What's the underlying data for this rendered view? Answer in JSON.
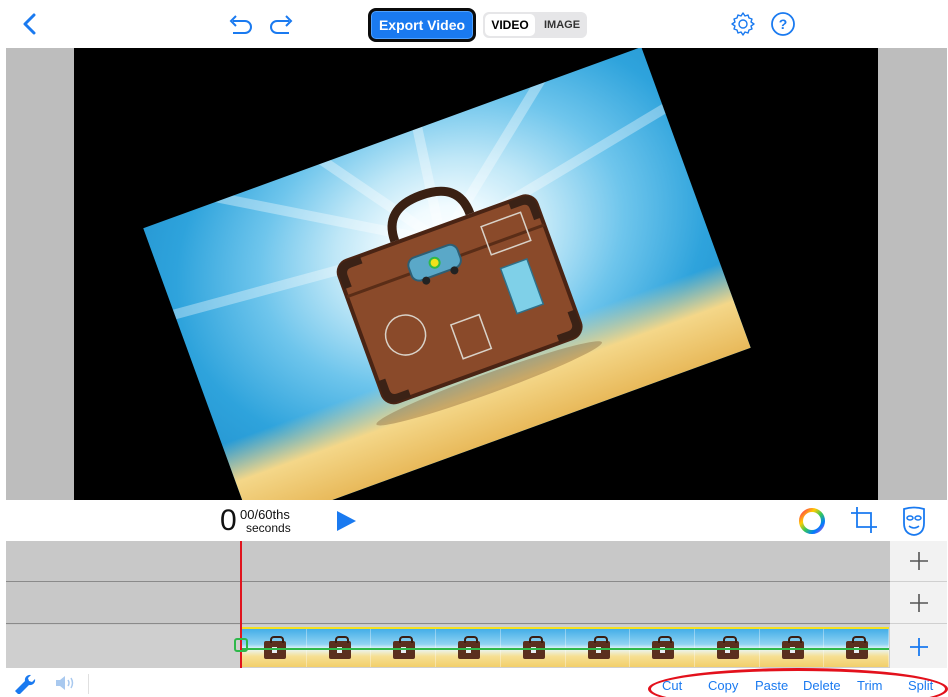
{
  "toolbar": {
    "export_label": "Export Video",
    "mode_video": "VIDEO",
    "mode_image": "IMAGE",
    "back_icon": "chevron-left-icon",
    "undo_icon": "undo-icon",
    "redo_icon": "redo-icon",
    "settings_icon": "gear-icon",
    "help_icon": "help-icon"
  },
  "playback": {
    "time_main": "0",
    "time_fraction": "00/60ths",
    "time_unit": "seconds",
    "play_icon": "play-icon"
  },
  "tools": {
    "color_icon": "color-wheel-icon",
    "crop_icon": "crop-icon",
    "mask_icon": "mask-icon"
  },
  "timeline": {
    "tracks": [
      {
        "add_label": "+"
      },
      {
        "add_label": "+"
      },
      {
        "add_label": "+"
      }
    ],
    "clip_frames": 10
  },
  "bottom": {
    "wrench_icon": "wrench-icon",
    "volume_icon": "volume-icon",
    "actions": [
      "Cut",
      "Copy",
      "Paste",
      "Delete",
      "Trim",
      "Split"
    ]
  },
  "colors": {
    "accent": "#1a7af0",
    "playhead": "#e0141e",
    "keyframe": "#2fb84a",
    "highlight": "#e3111c"
  }
}
